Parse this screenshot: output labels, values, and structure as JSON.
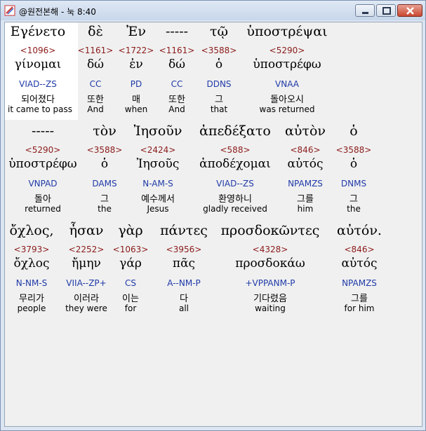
{
  "window": {
    "title": "@원전본해 - 눅 8:40"
  },
  "rows": [
    {
      "words": [
        {
          "greek": "Εγένετο",
          "strong": "<1096>",
          "lemma": "γίνομαι",
          "parse": "VIAD--ZS",
          "korean": "되어졌다",
          "english": "it came to pass"
        },
        {
          "greek": "δὲ",
          "strong": "<1161>",
          "lemma": "δώ",
          "parse": "CC",
          "korean": "또한",
          "english": "And"
        },
        {
          "greek": "Ἐν",
          "strong": "<1722>",
          "lemma": "ἐν",
          "parse": "PD",
          "korean": "매",
          "english": "when"
        },
        {
          "greek": "-----",
          "strong": "<1161>",
          "lemma": "δώ",
          "parse": "CC",
          "korean": "또한",
          "english": "And"
        },
        {
          "greek": "τῷ",
          "strong": "<3588>",
          "lemma": "ὁ",
          "parse": "DDNS",
          "korean": "그",
          "english": "that"
        },
        {
          "greek": "ὑποστρέψαι",
          "strong": "<5290>",
          "lemma": "ὑποστρέφω",
          "parse": "VNAA",
          "korean": "돌아오시",
          "english": "was returned"
        }
      ]
    },
    {
      "words": [
        {
          "greek": "-----",
          "strong": "<5290>",
          "lemma": "ὑποστρέφω",
          "parse": "VNPAD",
          "korean": "돌아",
          "english": "returned"
        },
        {
          "greek": "τὸν",
          "strong": "<3588>",
          "lemma": "ὁ",
          "parse": "DAMS",
          "korean": "그",
          "english": "the"
        },
        {
          "greek": "Ἰησοῦν",
          "strong": "<2424>",
          "lemma": "Ἰησοῦς",
          "parse": "N-AM-S",
          "korean": "예수께서",
          "english": "Jesus"
        },
        {
          "greek": "ἀπεδέξατο",
          "strong": "<588>",
          "lemma": "ἀποδέχομαι",
          "parse": "VIAD--ZS",
          "korean": "환영하니",
          "english": "gladly received"
        },
        {
          "greek": "αὐτὸν",
          "strong": "<846>",
          "lemma": "αὐτός",
          "parse": "NPAMZS",
          "korean": "그를",
          "english": "him"
        },
        {
          "greek": "ὁ",
          "strong": "<3588>",
          "lemma": "ὁ",
          "parse": "DNMS",
          "korean": "그",
          "english": "the"
        }
      ]
    },
    {
      "words": [
        {
          "greek": "ὄχλος,",
          "strong": "<3793>",
          "lemma": "ὄχλος",
          "parse": "N-NM-S",
          "korean": "무리가",
          "english": "people"
        },
        {
          "greek": "ἦσαν",
          "strong": "<2252>",
          "lemma": "ἤμην",
          "parse": "VIIA--ZP+",
          "korean": "이러라",
          "english": "they were"
        },
        {
          "greek": "γὰρ",
          "strong": "<1063>",
          "lemma": "γάρ",
          "parse": "CS",
          "korean": "이는",
          "english": "for"
        },
        {
          "greek": "πάντες",
          "strong": "<3956>",
          "lemma": "πᾶς",
          "parse": "A--NM-P",
          "korean": "다",
          "english": "all"
        },
        {
          "greek": "προσδοκῶντες",
          "strong": "<4328>",
          "lemma": "προσδοκάω",
          "parse": "+VPPANM-P",
          "korean": "기다렸음",
          "english": "waiting"
        },
        {
          "greek": "αὐτόν.",
          "strong": "<846>",
          "lemma": "αὐτός",
          "parse": "NPAMZS",
          "korean": "그를",
          "english": "for him"
        }
      ]
    }
  ]
}
